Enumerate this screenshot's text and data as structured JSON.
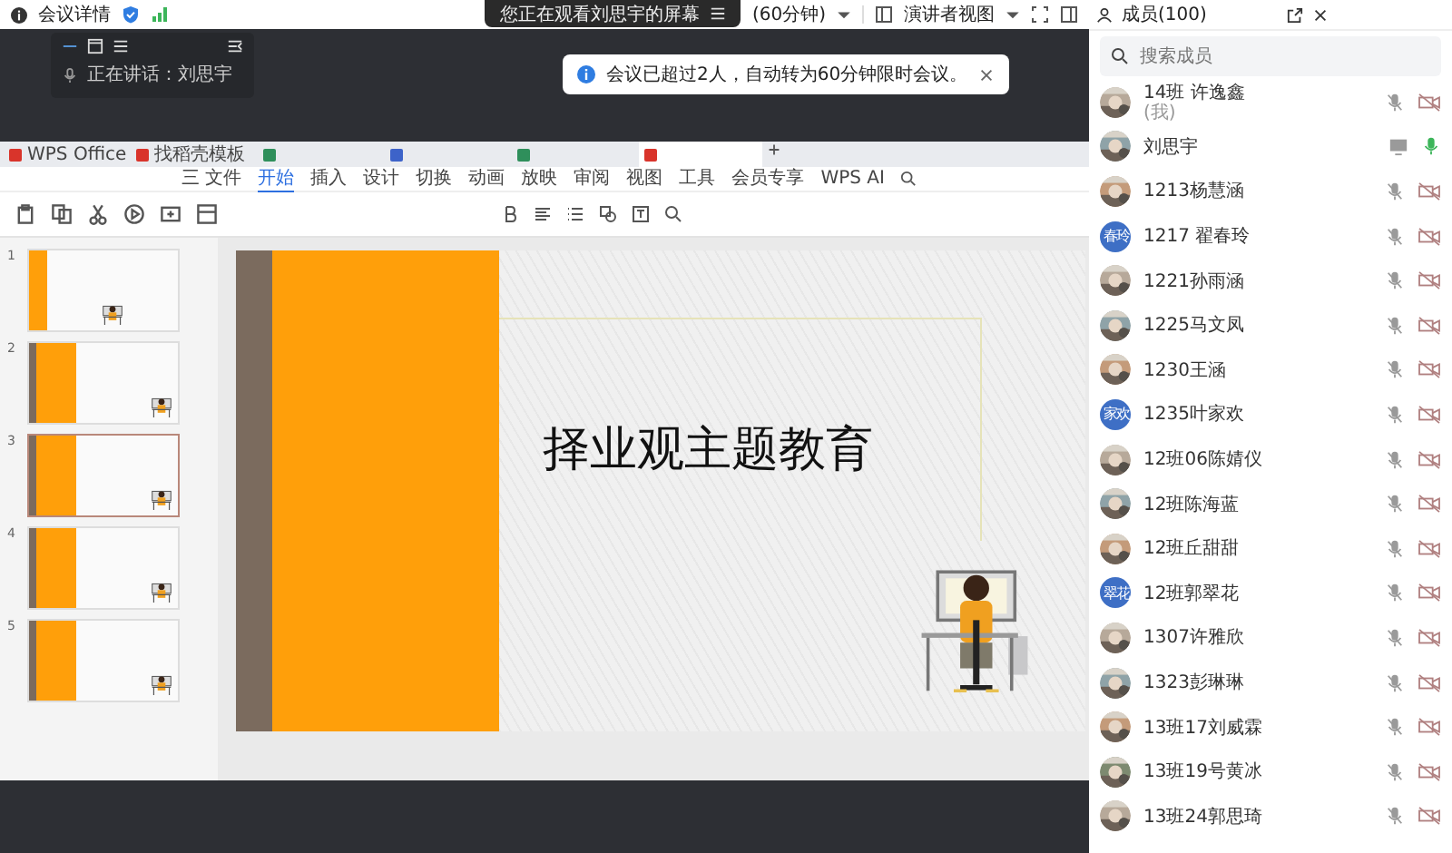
{
  "top_bar": {
    "title": "会议详情",
    "share_notice": "您正在观看刘思宇的屏幕",
    "timer": "(60分钟)",
    "view_mode": "演讲者视图"
  },
  "speaker_panel": {
    "speaking": "正在讲话：刘思宇"
  },
  "toast": {
    "message": "会议已超过2人，自动转为60分钟限时会议。"
  },
  "shared_screen": {
    "tabs": [
      {
        "label": "WPS Office",
        "color": "#d9342b",
        "selected": false
      },
      {
        "label": "找稻壳模板",
        "color": "#d9342b",
        "selected": false
      },
      {
        "color": "#2f8f5b",
        "selected": false
      },
      {
        "color": "#3d63c9",
        "selected": false
      },
      {
        "color": "#2f8f5b",
        "selected": false
      },
      {
        "color": "#d9342b",
        "selected": true
      }
    ],
    "menu": [
      {
        "label": "三 文件",
        "selected": false
      },
      {
        "label": "开始",
        "selected": true
      },
      {
        "label": "插入",
        "selected": false
      },
      {
        "label": "设计",
        "selected": false
      },
      {
        "label": "切换",
        "selected": false
      },
      {
        "label": "动画",
        "selected": false
      },
      {
        "label": "放映",
        "selected": false
      },
      {
        "label": "审阅",
        "selected": false
      },
      {
        "label": "视图",
        "selected": false
      },
      {
        "label": "工具",
        "selected": false
      },
      {
        "label": "会员专享",
        "selected": false
      },
      {
        "label": "WPS AI",
        "selected": false
      }
    ],
    "slides": [
      {
        "number": "1",
        "kind": "cover",
        "selected": false
      },
      {
        "number": "2",
        "kind": "title",
        "selected": false
      },
      {
        "number": "3",
        "kind": "title",
        "selected": true
      },
      {
        "number": "4",
        "kind": "title",
        "selected": false
      },
      {
        "number": "5",
        "kind": "title",
        "selected": false
      }
    ],
    "slide": {
      "title": "择业观主题教育"
    }
  },
  "members": {
    "title": "成员(100)",
    "search": {
      "placeholder": "搜索成员"
    },
    "items": [
      {
        "name": "14班 许逸鑫",
        "note": "(我)",
        "muted": true,
        "sharing": false
      },
      {
        "name": "刘思宇",
        "muted": false,
        "sharing": true
      },
      {
        "name": "1213杨慧涵",
        "muted": true,
        "sharing": false
      },
      {
        "name": "1217 翟春玲",
        "avatar": {
          "kind": "text",
          "text": "春玲"
        },
        "muted": true,
        "sharing": false
      },
      {
        "name": "1221孙雨涵",
        "muted": true,
        "sharing": false
      },
      {
        "name": "1225马文凤",
        "muted": true,
        "sharing": false
      },
      {
        "name": "1230王涵",
        "muted": true,
        "sharing": false
      },
      {
        "name": "1235叶家欢",
        "avatar": {
          "kind": "text",
          "text": "家欢"
        },
        "muted": true,
        "sharing": false
      },
      {
        "name": "12班06陈婧仪",
        "muted": true,
        "sharing": false
      },
      {
        "name": "12班陈海蓝",
        "muted": true,
        "sharing": false
      },
      {
        "name": "12班丘甜甜",
        "muted": true,
        "sharing": false
      },
      {
        "name": "12班郭翠花",
        "avatar": {
          "kind": "text",
          "text": "翠花"
        },
        "muted": true,
        "sharing": false
      },
      {
        "name": "1307许雅欣",
        "muted": true,
        "sharing": false
      },
      {
        "name": "1323彭琳琳",
        "muted": true,
        "sharing": false
      },
      {
        "name": "13班17刘威霖",
        "muted": true,
        "sharing": false
      },
      {
        "name": "13班19号黄冰",
        "muted": true,
        "sharing": false
      },
      {
        "name": "13班24郭思琦",
        "muted": true,
        "sharing": false
      }
    ]
  }
}
